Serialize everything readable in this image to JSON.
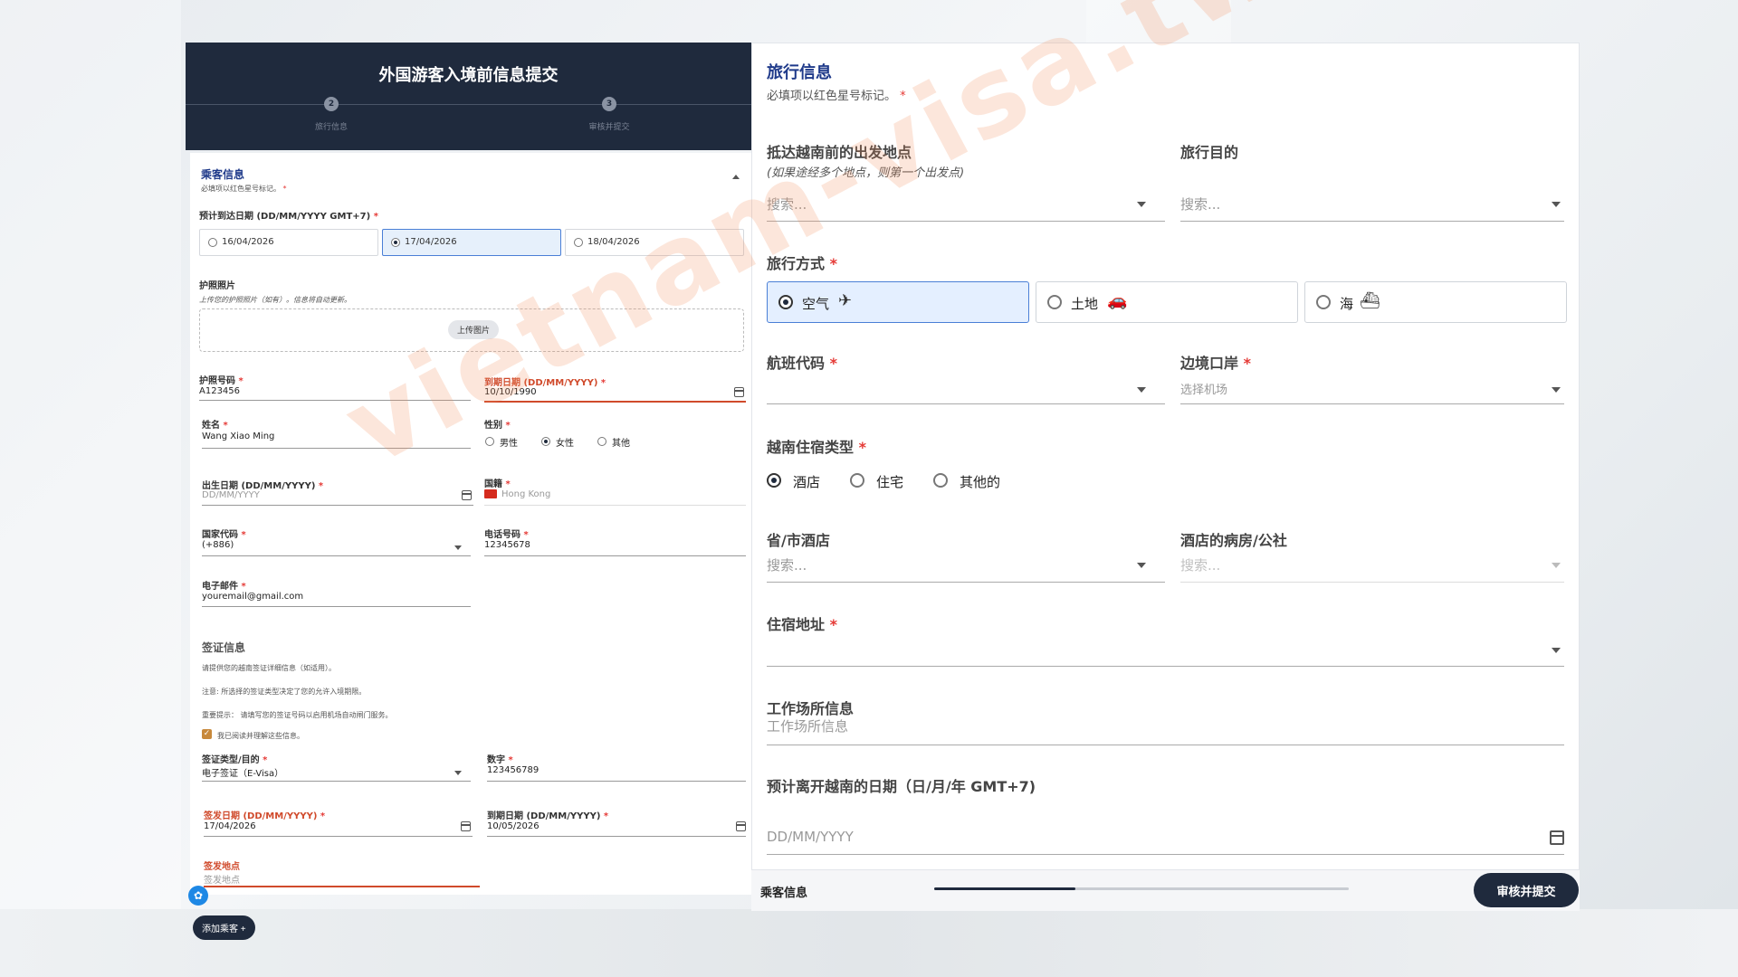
{
  "left": {
    "title": "外国游客入境前信息提交",
    "steps": [
      {
        "num": "2",
        "label": "旅行信息"
      },
      {
        "num": "3",
        "label": "审核并提交"
      }
    ],
    "passenger": {
      "title": "乘客信息",
      "required_note": "必填项以红色星号标记。",
      "arrival_label": "预计到达日期 (DD/MM/YYYY GMT+7)",
      "arrival_options": [
        "16/04/2026",
        "17/04/2026",
        "18/04/2026"
      ],
      "arrival_selected": "17/04/2026",
      "photo_label": "护照照片",
      "photo_hint": "上传您的护照照片（如有）。信息将自动更新。",
      "upload_button": "上传图片",
      "passport_label": "护照号码",
      "passport_value": "A123456",
      "expiry_label": "到期日期 (DD/MM/YYYY)",
      "expiry_value": "10/10/1990",
      "name_label": "姓名",
      "name_value": "Wang Xiao Ming",
      "gender_label": "性别",
      "gender_options": [
        "男性",
        "女性",
        "其他"
      ],
      "gender_selected": "女性",
      "dob_label": "出生日期 (DD/MM/YYYY)",
      "dob_placeholder": "DD/MM/YYYY",
      "nationality_label": "国籍",
      "nationality_value": "Hong Kong",
      "country_code_label": "国家代码",
      "country_code_value": "(+886)",
      "phone_label": "电话号码",
      "phone_value": "12345678",
      "email_label": "电子邮件",
      "email_value": "youremail@gmail.com"
    },
    "visa": {
      "title": "签证信息",
      "note1": "请提供您的越南签证详细信息（如适用）。",
      "note2": "注意: 所选择的签证类型决定了您的允许入境期限。",
      "note3": "重要提示： 请填写您的签证号码以启用机场自动闸门服务。",
      "ack": "我已阅读并理解这些信息。",
      "type_label": "签证类型/目的",
      "type_value": "电子签证（E-Visa）",
      "number_label": "数字",
      "number_value": "123456789",
      "issue_label": "签发日期 (DD/MM/YYYY)",
      "issue_value": "17/04/2026",
      "expiry_label": "到期日期 (DD/MM/YYYY)",
      "expiry_value": "10/05/2026",
      "place_label": "签发地点",
      "place_placeholder": "签发地点"
    },
    "add_passenger": "添加乘客 +"
  },
  "right": {
    "title": "旅行信息",
    "required_note": "必填项以红色星号标记。",
    "departure_label": "抵达越南前的出发地点",
    "departure_sub": "(如果途经多个地点，则第一个出发点)",
    "search_placeholder": "搜索...",
    "purpose_label": "旅行目的",
    "mode_label": "旅行方式",
    "modes": [
      {
        "label": "空气",
        "icon": "✈"
      },
      {
        "label": "土地",
        "icon": "🚗"
      },
      {
        "label": "海",
        "icon": "⛴"
      }
    ],
    "mode_selected": "空气",
    "flight_label": "航班代码",
    "border_label": "边境口岸",
    "border_placeholder": "选择机场",
    "accom_type_label": "越南住宿类型",
    "accom_types": [
      "酒店",
      "住宅",
      "其他的"
    ],
    "accom_selected": "酒店",
    "province_label": "省/市酒店",
    "ward_label": "酒店的病房/公社",
    "address_label": "住宿地址",
    "workplace_label": "工作场所信息",
    "workplace_placeholder": "工作场所信息",
    "leave_label": "预计离开越南的日期（日/月/年 GMT+7)",
    "leave_placeholder": "DD/MM/YYYY"
  },
  "bottom": {
    "label": "乘客信息",
    "progress": 0.34,
    "submit": "审核并提交"
  },
  "watermark": "vietnam-visa.tw"
}
